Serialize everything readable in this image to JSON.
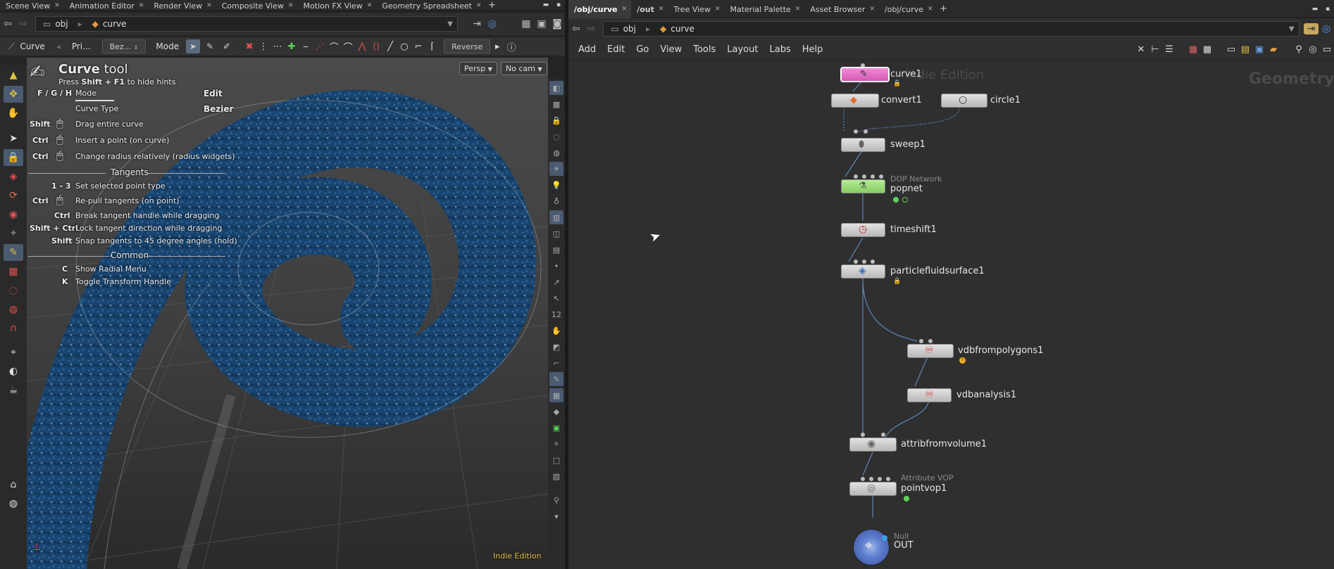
{
  "left_pane": {
    "tabs": [
      {
        "label": "Scene View"
      },
      {
        "label": "Animation Editor"
      },
      {
        "label": "Render View"
      },
      {
        "label": "Composite View"
      },
      {
        "label": "Motion FX View"
      },
      {
        "label": "Geometry Spreadsheet"
      }
    ],
    "path": {
      "root": "obj",
      "current": "curve"
    },
    "toolbar": {
      "tool_name": "Curve",
      "primitive_label": "Pri...",
      "type_select": "Bez...",
      "mode_label": "Mode",
      "reverse_button": "Reverse"
    },
    "viewport": {
      "persp_button": "Persp",
      "cam_button": "No cam",
      "edition_label": "Indie Edition",
      "hints": {
        "title_bold": "Curve",
        "title_rest": " tool",
        "subtitle_prefix": "Press ",
        "subtitle_key": "Shift + F1",
        "subtitle_suffix": " to hide hints",
        "mode_keys": "F / G / H",
        "mode_label": "Mode",
        "mode_value": "Edit",
        "curve_type_label": "Curve Type",
        "curve_type_value": "Bezier",
        "rows": [
          {
            "key": "Shift",
            "mouse": true,
            "desc": "Drag entire curve"
          },
          {
            "key": "Ctrl",
            "mouse": true,
            "desc": "Insert a point (on curve)"
          },
          {
            "key": "Ctrl",
            "mouse": true,
            "desc": "Change radius relatively (radius widgets)"
          }
        ],
        "section_tangents": "Tangents",
        "tangent_rows": [
          {
            "key": "1 - 3",
            "desc": "Set selected point type"
          },
          {
            "key": "Ctrl",
            "desc": "Re-pull tangents (on point)"
          },
          {
            "key": "Ctrl",
            "desc": "Break tangent handle while dragging"
          },
          {
            "key": "Shift + Ctrl",
            "desc": "Lock tangent direction while dragging"
          },
          {
            "key": "Shift",
            "desc": "Snap tangents to 45 degree angles (hold)"
          }
        ],
        "section_common": "Common",
        "common_rows": [
          {
            "key": "C",
            "desc": "Show Radial Menu"
          },
          {
            "key": "K",
            "desc": "Toggle Transform Handle"
          }
        ]
      }
    }
  },
  "right_pane": {
    "tabs": [
      {
        "label": "/obj/curve",
        "active": true
      },
      {
        "label": "/out"
      },
      {
        "label": "Tree View"
      },
      {
        "label": "Material Palette"
      },
      {
        "label": "Asset Browser"
      },
      {
        "label": "/obj/curve"
      }
    ],
    "path": {
      "root": "obj",
      "current": "curve"
    },
    "menu": [
      "Add",
      "Edit",
      "Go",
      "View",
      "Tools",
      "Layout",
      "Labs",
      "Help"
    ],
    "watermark_edition": "Indie Edition",
    "watermark_context": "Geometry",
    "nodes": [
      {
        "id": "curve1",
        "label": "curve1"
      },
      {
        "id": "convert1",
        "label": "convert1"
      },
      {
        "id": "circle1",
        "label": "circle1"
      },
      {
        "id": "sweep1",
        "label": "sweep1"
      },
      {
        "id": "popnet",
        "label": "popnet",
        "type": "DOP Network"
      },
      {
        "id": "timeshift1",
        "label": "timeshift1"
      },
      {
        "id": "particlefluidsurface1",
        "label": "particlefluidsurface1"
      },
      {
        "id": "vdbfrompolygons1",
        "label": "vdbfrompolygons1"
      },
      {
        "id": "vdbanalysis1",
        "label": "vdbanalysis1"
      },
      {
        "id": "attribfromvolume1",
        "label": "attribfromvolume1"
      },
      {
        "id": "pointvop1",
        "label": "pointvop1",
        "type": "Attribute VOP"
      },
      {
        "id": "OUT",
        "label": "OUT",
        "type": "Null"
      }
    ],
    "colors": {
      "curve1": "#e86ec8",
      "popnet": "#9de07a",
      "out": "#4c6cc0",
      "wire": "#5f86b8"
    }
  }
}
